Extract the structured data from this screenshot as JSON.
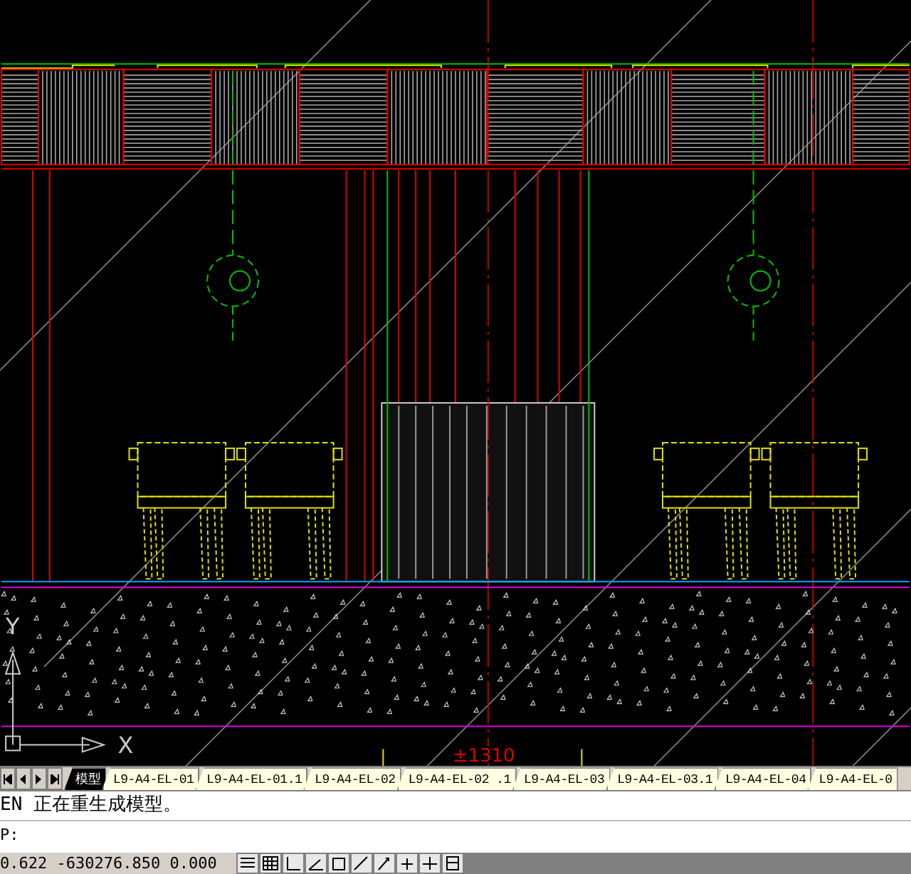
{
  "drawing": {
    "elevation_label": "±1310",
    "ucs": {
      "y_label": "Y",
      "x_label": "X"
    }
  },
  "layout_tabs": [
    {
      "label": "模型",
      "selected": true
    },
    {
      "label": "L9-A4-EL-01",
      "selected": false
    },
    {
      "label": "L9-A4-EL-01.1",
      "selected": false
    },
    {
      "label": "L9-A4-EL-02",
      "selected": false
    },
    {
      "label": "L9-A4-EL-02 .1",
      "selected": false
    },
    {
      "label": "L9-A4-EL-03",
      "selected": false
    },
    {
      "label": "L9-A4-EL-03.1",
      "selected": false
    },
    {
      "label": "L9-A4-EL-04",
      "selected": false
    },
    {
      "label": "L9-A4-EL-0",
      "selected": false
    }
  ],
  "command_line": {
    "history": "EN 正在重生成模型。",
    "prompt": "P:"
  },
  "status_bar": {
    "coordinates": "0.622  -630276.850  0.000"
  }
}
